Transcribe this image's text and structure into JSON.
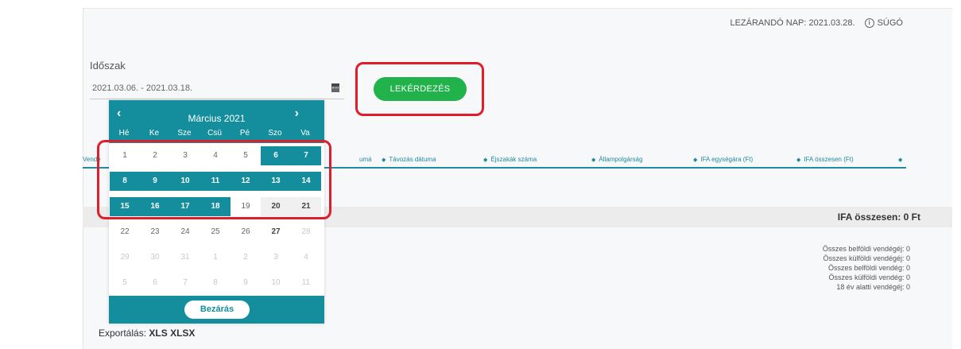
{
  "header": {
    "closing_day": "LEZÁRANDÓ NAP: 2021.03.28.",
    "help_icon": "info-circle-icon",
    "help_label": "SÚGÓ"
  },
  "filter": {
    "period_label": "Időszak",
    "date_range": "2021.03.06. - 2021.03.18.",
    "calendar_icon": "calendar-icon",
    "query_button": "LEKÉRDEZÉS",
    "accent_color": "#22b24c",
    "highlight_color": "#e01d2b"
  },
  "table": {
    "columns": [
      {
        "label": "Vendé"
      },
      {
        "label": "umá"
      },
      {
        "label": "Távozás dátuma"
      },
      {
        "label": "Éjszakák száma"
      },
      {
        "label": "Állampolgárság"
      },
      {
        "label": "IFA egységára (Ft)"
      },
      {
        "label": "IFA összesen (Ft)"
      }
    ],
    "sort_icon": "sort-icon",
    "header_color": "#1f8aa0"
  },
  "summary": {
    "ifa_total": "IFA összesen: 0 Ft"
  },
  "stats": [
    "Összes belföldi vendégéj: 0",
    "Összes külföldi vendégéj: 0",
    "Összes belföldi vendég: 0",
    "Összes külföldi vendég: 0",
    "18 év alatti vendégéj: 0"
  ],
  "export": {
    "label": "Exportálás:",
    "xls": "XLS",
    "xlsx": "XLSX"
  },
  "calendar": {
    "month_title": "Március 2021",
    "prev_icon": "chevron-left-icon",
    "next_icon": "chevron-right-icon",
    "weekdays": [
      "Hé",
      "Ke",
      "Sze",
      "Csü",
      "Pé",
      "Szo",
      "Va"
    ],
    "weeks": [
      [
        {
          "d": "1",
          "s": ""
        },
        {
          "d": "2",
          "s": ""
        },
        {
          "d": "3",
          "s": ""
        },
        {
          "d": "4",
          "s": ""
        },
        {
          "d": "5",
          "s": ""
        },
        {
          "d": "6",
          "s": "sel"
        },
        {
          "d": "7",
          "s": "sel"
        }
      ],
      [
        {
          "d": "8",
          "s": "sel"
        },
        {
          "d": "9",
          "s": "sel"
        },
        {
          "d": "10",
          "s": "sel"
        },
        {
          "d": "11",
          "s": "sel"
        },
        {
          "d": "12",
          "s": "sel"
        },
        {
          "d": "13",
          "s": "sel"
        },
        {
          "d": "14",
          "s": "sel"
        }
      ],
      [
        {
          "d": "15",
          "s": "sel"
        },
        {
          "d": "16",
          "s": "sel"
        },
        {
          "d": "17",
          "s": "sel"
        },
        {
          "d": "18",
          "s": "sel"
        },
        {
          "d": "19",
          "s": ""
        },
        {
          "d": "20",
          "s": "wes"
        },
        {
          "d": "21",
          "s": "wes"
        }
      ],
      [
        {
          "d": "22",
          "s": ""
        },
        {
          "d": "23",
          "s": ""
        },
        {
          "d": "24",
          "s": ""
        },
        {
          "d": "25",
          "s": ""
        },
        {
          "d": "26",
          "s": ""
        },
        {
          "d": "27",
          "s": "we"
        },
        {
          "d": "28",
          "s": "faded"
        }
      ],
      [
        {
          "d": "29",
          "s": "faded"
        },
        {
          "d": "30",
          "s": "faded"
        },
        {
          "d": "31",
          "s": "faded"
        },
        {
          "d": "1",
          "s": "other"
        },
        {
          "d": "2",
          "s": "other"
        },
        {
          "d": "3",
          "s": "other"
        },
        {
          "d": "4",
          "s": "other"
        }
      ],
      [
        {
          "d": "5",
          "s": "other"
        },
        {
          "d": "6",
          "s": "other"
        },
        {
          "d": "7",
          "s": "other"
        },
        {
          "d": "8",
          "s": "other"
        },
        {
          "d": "9",
          "s": "other"
        },
        {
          "d": "10",
          "s": "other"
        },
        {
          "d": "11",
          "s": "other"
        }
      ]
    ],
    "close_button": "Bezárás",
    "theme_color": "#148e9c"
  }
}
